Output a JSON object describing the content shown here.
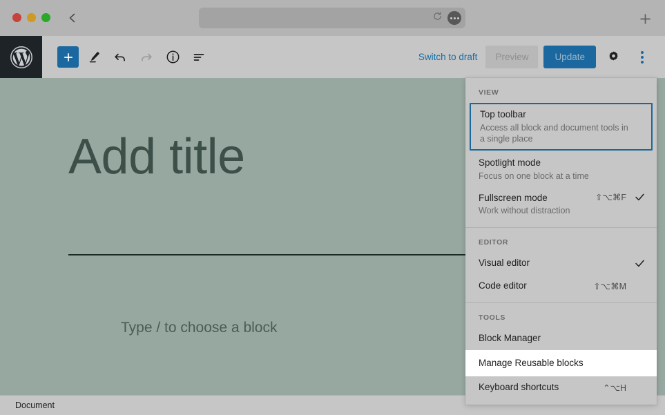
{
  "browser": {
    "traffic_lights": [
      "close",
      "minimize",
      "maximize"
    ],
    "back_icon": "chevron-left-icon",
    "address_value": "",
    "address_placeholder": "",
    "reload_icon": "reload-icon",
    "page_menu_icon": "ellipsis-icon",
    "new_tab_label": "+"
  },
  "editor_toolbar": {
    "logo": "wordpress-logo",
    "add_block_label": "+",
    "tools_icon": "pencil-icon",
    "undo_icon": "undo-icon",
    "redo_icon": "redo-icon",
    "details_icon": "info-icon",
    "list_view_icon": "list-view-icon",
    "switch_to_draft_label": "Switch to draft",
    "preview_label": "Preview",
    "update_label": "Update",
    "settings_icon": "gear-icon",
    "more_options_icon": "kebab-icon"
  },
  "canvas": {
    "title_placeholder": "Add title",
    "block_placeholder": "Type / to choose a block",
    "background_color": "#96a8a0"
  },
  "bottom_bar": {
    "breadcrumb": "Document"
  },
  "more_menu": {
    "accent_color": "#1a6897",
    "sections": [
      {
        "label": "VIEW",
        "items": [
          {
            "title": "Top toolbar",
            "desc": "Access all block and document tools in a single place",
            "shortcut": "",
            "checked": false,
            "state": "focused"
          },
          {
            "title": "Spotlight mode",
            "desc": "Focus on one block at a time",
            "shortcut": "",
            "checked": false,
            "state": "normal"
          },
          {
            "title": "Fullscreen mode",
            "desc": "Work without distraction",
            "shortcut": "⇧⌥⌘F",
            "checked": true,
            "state": "normal"
          }
        ]
      },
      {
        "label": "EDITOR",
        "items": [
          {
            "title": "Visual editor",
            "desc": "",
            "shortcut": "",
            "checked": true,
            "state": "normal"
          },
          {
            "title": "Code editor",
            "desc": "",
            "shortcut": "⇧⌥⌘M",
            "checked": false,
            "state": "normal"
          }
        ]
      },
      {
        "label": "TOOLS",
        "items": [
          {
            "title": "Block Manager",
            "desc": "",
            "shortcut": "",
            "checked": false,
            "state": "normal"
          },
          {
            "title": "Manage Reusable blocks",
            "desc": "",
            "shortcut": "",
            "checked": false,
            "state": "hovered"
          },
          {
            "title": "Keyboard shortcuts",
            "desc": "",
            "shortcut": "⌃⌥H",
            "checked": false,
            "state": "normal"
          }
        ]
      }
    ]
  }
}
